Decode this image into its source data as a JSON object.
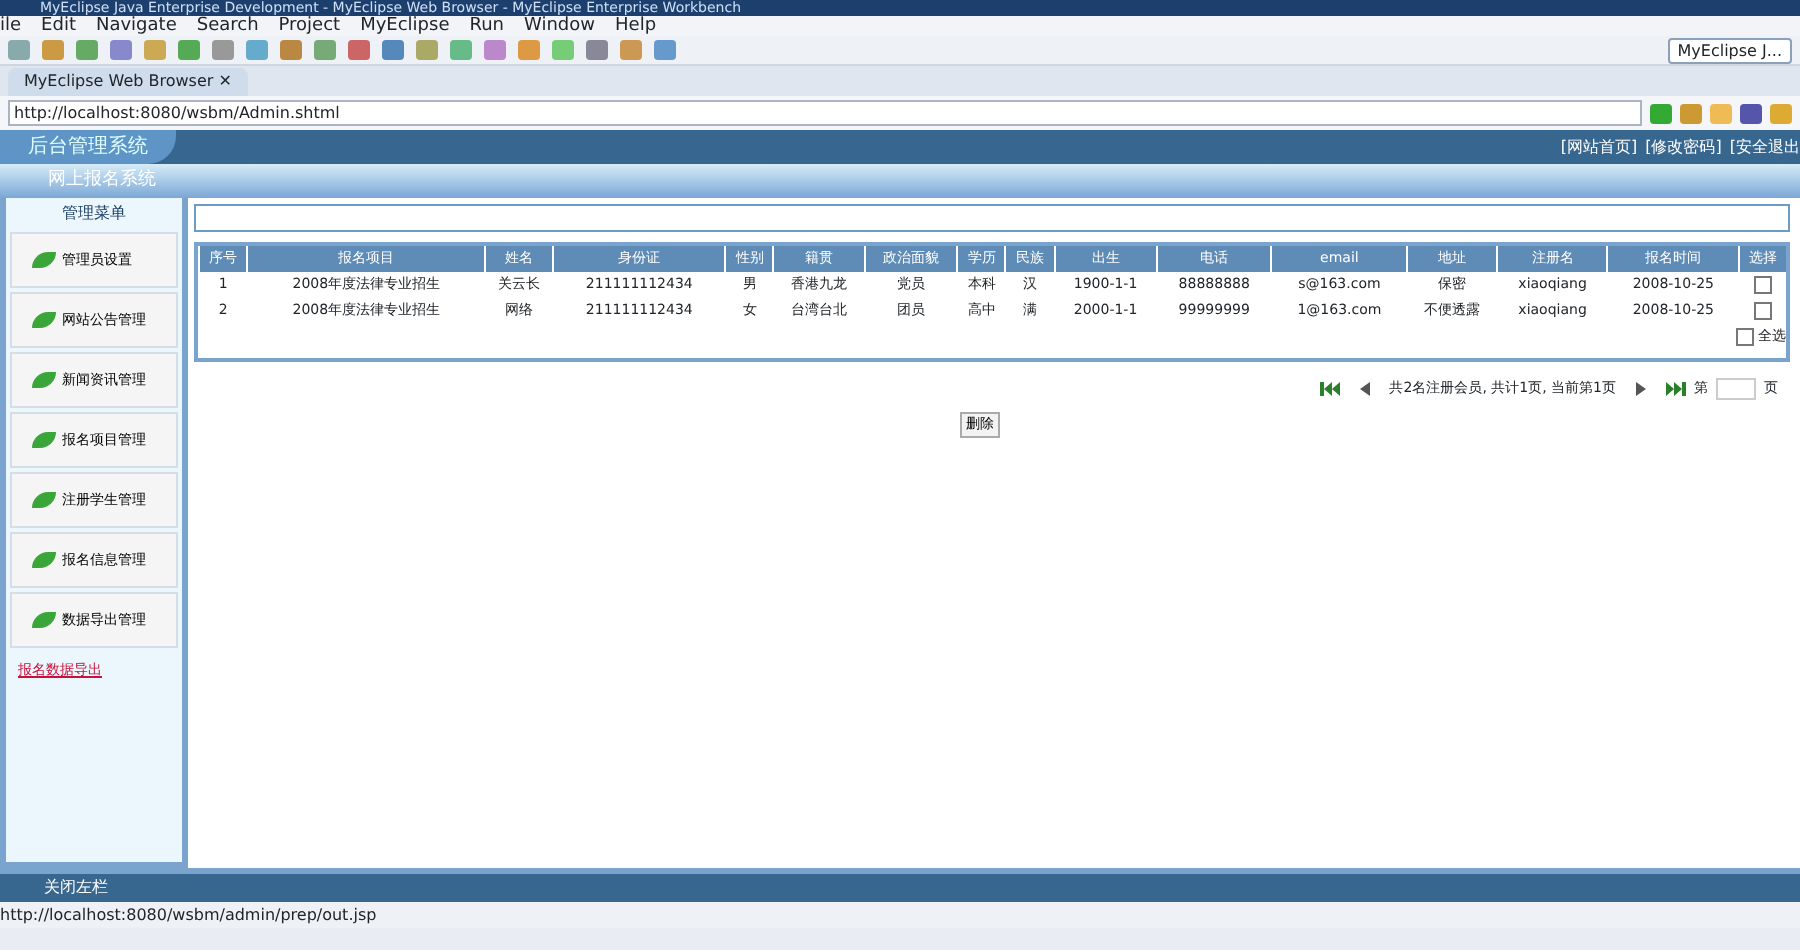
{
  "window": {
    "title": "MyEclipse Java Enterprise Development - MyEclipse Web Browser - MyEclipse Enterprise Workbench"
  },
  "menu": [
    "ile",
    "Edit",
    "Navigate",
    "Search",
    "Project",
    "MyEclipse",
    "Run",
    "Window",
    "Help"
  ],
  "perspective": {
    "label": "MyEclipse J..."
  },
  "editor_tab": {
    "label": "MyEclipse Web Browser",
    "close": "✕"
  },
  "address": {
    "value": "http://localhost:8080/wsbm/Admin.shtml"
  },
  "page": {
    "logo": "后台管理系统",
    "top_links": [
      "[网站首页]",
      "[修改密码]",
      "[安全退出"
    ],
    "subtitle": "网上报名系统",
    "sidebar": {
      "title": "管理菜单",
      "items": [
        {
          "label": "管理员设置",
          "kind": "button",
          "selected": false
        },
        {
          "label": "网站公告管理",
          "kind": "button",
          "selected": false
        },
        {
          "label": "新闻资讯管理",
          "kind": "button",
          "selected": false
        },
        {
          "label": "报名项目管理",
          "kind": "button",
          "selected": false
        },
        {
          "label": "注册学生管理",
          "kind": "button",
          "selected": false
        },
        {
          "label": "报名信息管理",
          "kind": "button",
          "selected": false
        },
        {
          "label": "数据导出管理",
          "kind": "button",
          "selected": false
        },
        {
          "label": "报名数据导出",
          "kind": "link",
          "selected": true
        }
      ]
    },
    "table": {
      "columns": [
        "序号",
        "报名项目",
        "姓名",
        "身份证",
        "性别",
        "籍贯",
        "政治面貌",
        "学历",
        "民族",
        "出生",
        "电话",
        "email",
        "地址",
        "注册名",
        "报名时间",
        "选择"
      ],
      "rows": [
        {
          "cells": [
            "1",
            "2008年度法律专业招生",
            "关云长",
            "211111112434",
            "男",
            "香港九龙",
            "党员",
            "本科",
            "汉",
            "1900-1-1",
            "88888888",
            "s@163.com",
            "保密",
            "xiaoqiang",
            "2008-10-25"
          ],
          "checked": false
        },
        {
          "cells": [
            "2",
            "2008年度法律专业招生",
            "网络",
            "211111112434",
            "女",
            "台湾台北",
            "团员",
            "高中",
            "满",
            "2000-1-1",
            "99999999",
            "1@163.com",
            "不便透露",
            "xiaoqiang",
            "2008-10-25"
          ],
          "checked": false
        }
      ],
      "select_all": {
        "label": "全选",
        "checked": false
      }
    },
    "pager": {
      "summary": "共2名注册会员, 共计1页, 当前第1页",
      "page_prefix": "第",
      "page_suffix": "页"
    },
    "delete_button": "删除",
    "footer": "关闭左栏"
  },
  "status_bar": "http://localhost:8080/wsbm/admin/prep/out.jsp"
}
